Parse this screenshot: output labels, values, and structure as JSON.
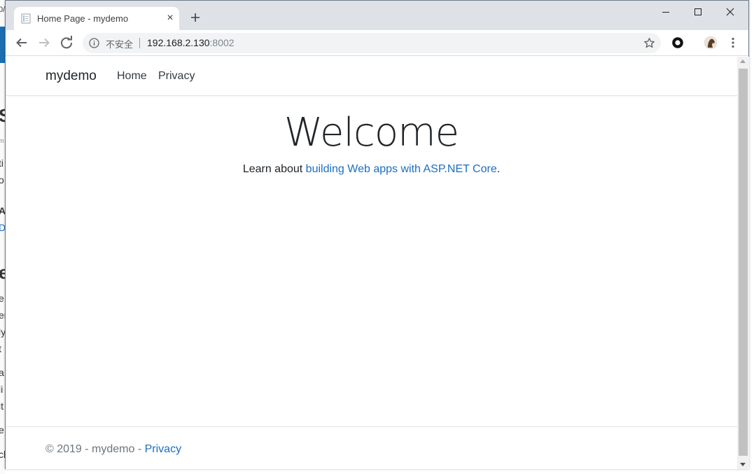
{
  "browser": {
    "tab_title": "Home Page - mydemo",
    "tab_close": "×",
    "security_label": "不安全",
    "url_host": "192.168.2.130",
    "url_port": ":8002"
  },
  "site": {
    "brand": "mydemo",
    "nav": {
      "home": "Home",
      "privacy": "Privacy"
    },
    "heading": "Welcome",
    "lead_prefix": "Learn about ",
    "lead_link": "building Web apps with ASP.NET Core",
    "lead_suffix": ".",
    "footer_text": "© 2019 - mydemo - ",
    "footer_link": "Privacy"
  },
  "background_fragments": [
    "0/",
    "S",
    "m",
    "ti",
    "o",
    "A",
    "D",
    "e",
    "e",
    "er",
    "ly",
    "t",
    "a",
    "li",
    "it",
    "e",
    "ck"
  ],
  "colors": {
    "link": "#1b6ec2",
    "titlebar": "#dee1e6",
    "omnibox": "#f1f3f4",
    "text": "#212529"
  }
}
